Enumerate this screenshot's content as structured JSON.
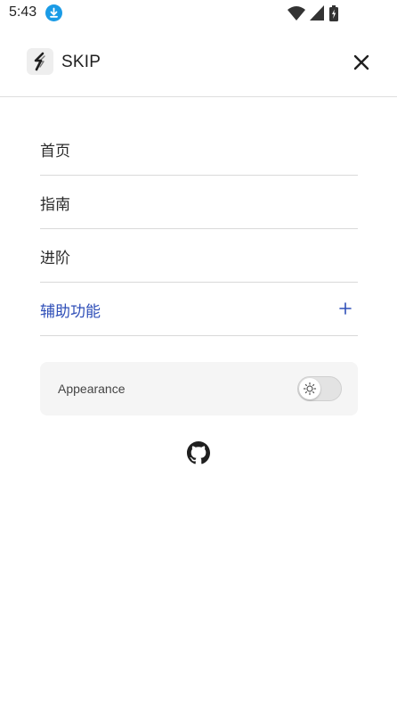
{
  "status_bar": {
    "time": "5:43",
    "icons": [
      "download-icon",
      "wifi-icon",
      "cellular-signal-icon",
      "battery-icon"
    ]
  },
  "header": {
    "brand": "SKIP",
    "logo_icon": "skip-logo-icon",
    "close_icon": "close-icon"
  },
  "nav": {
    "items": [
      {
        "label": "首页",
        "active": false
      },
      {
        "label": "指南",
        "active": false
      },
      {
        "label": "进阶",
        "active": false
      },
      {
        "label": "辅助功能",
        "active": true,
        "expand_icon": "plus-icon"
      }
    ]
  },
  "appearance": {
    "label": "Appearance",
    "toggle_icon": "sun-icon",
    "dark_mode": false
  },
  "footer": {
    "icon": "github-icon"
  },
  "colors": {
    "accent": "#2f4fb8",
    "status_download": "#1a9be6",
    "divider": "#d9d9d9",
    "panel_bg": "#f5f5f5"
  }
}
